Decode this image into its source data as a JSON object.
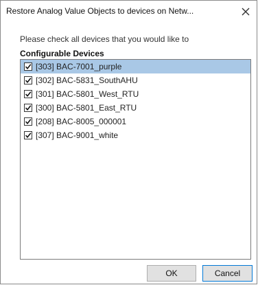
{
  "dialog": {
    "title": "Restore Analog Value Objects to devices on Netw...",
    "instructions": "Please check all devices that you would like to",
    "group_label": "Configurable Devices",
    "devices": [
      {
        "label": "[303] BAC-7001_purple",
        "checked": true,
        "selected": true
      },
      {
        "label": "[302] BAC-5831_SouthAHU",
        "checked": true,
        "selected": false
      },
      {
        "label": "[301] BAC-5801_West_RTU",
        "checked": true,
        "selected": false
      },
      {
        "label": "[300] BAC-5801_East_RTU",
        "checked": true,
        "selected": false
      },
      {
        "label": "[208] BAC-8005_000001",
        "checked": true,
        "selected": false
      },
      {
        "label": "[307] BAC-9001_white",
        "checked": true,
        "selected": false
      }
    ],
    "ok_label": "OK",
    "cancel_label": "Cancel"
  },
  "icons": {
    "close": "close-icon",
    "check": "checkmark-icon"
  },
  "colors": {
    "selection": "#a9c8e6",
    "focus_border": "#0078d7"
  }
}
